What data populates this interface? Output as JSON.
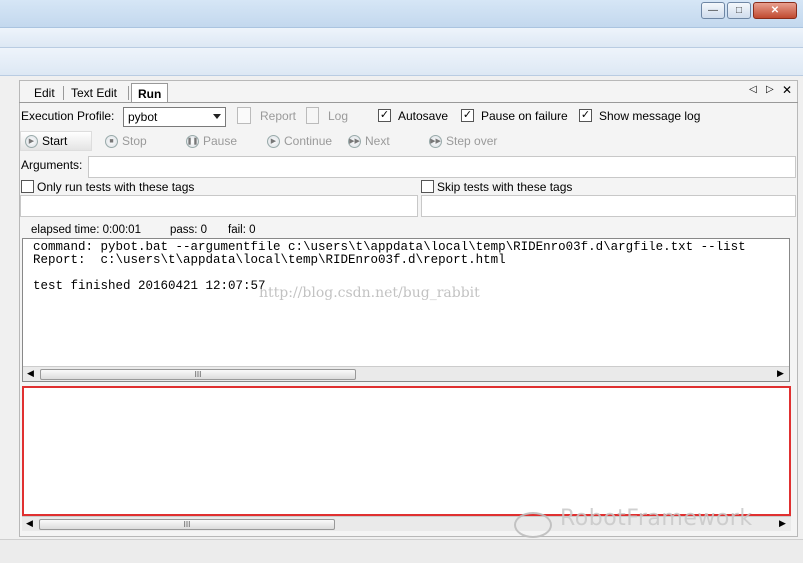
{
  "tabs": [
    {
      "label": "Edit"
    },
    {
      "label": "Text Edit"
    },
    {
      "label": "Run"
    }
  ],
  "profile": {
    "label": "Execution Profile:",
    "selected": "pybot",
    "report": "Report",
    "log": "Log",
    "autosave": "Autosave",
    "pause_on_failure": "Pause on failure",
    "show_message_log": "Show message log"
  },
  "toolbar": {
    "start": "Start",
    "stop": "Stop",
    "pause": "Pause",
    "continue": "Continue",
    "next": "Next",
    "step_over": "Step over"
  },
  "arguments_label": "Arguments:",
  "only_run_tags": "Only run tests with these tags",
  "skip_tags": "Skip tests with these tags",
  "status": {
    "elapsed": "elapsed time: 0:00:01",
    "pass": "pass: 0",
    "fail": "fail: 0"
  },
  "output": {
    "line1": "command: pybot.bat --argumentfile c:\\users\\t\\appdata\\local\\temp\\RIDEnro03f.d\\argfile.txt --list",
    "line2": "Report:  c:\\users\\t\\appdata\\local\\temp\\RIDEnro03f.d\\report.html",
    "line3": "test finished 20160421 12:07:57"
  },
  "watermark": "http://blog.csdn.net/bug_rabbit",
  "brand": "RobotFramework"
}
